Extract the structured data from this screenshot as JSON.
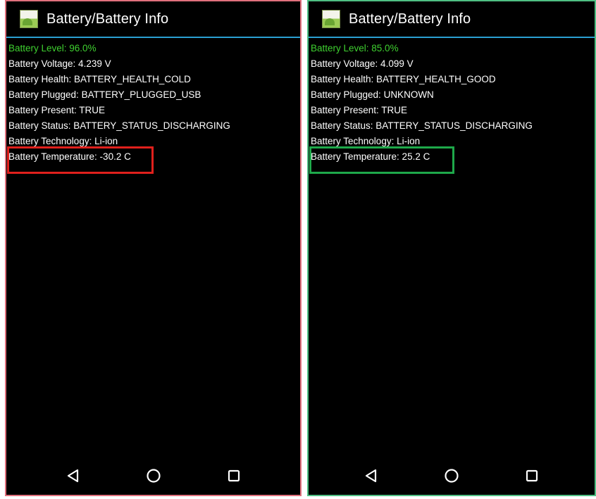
{
  "colors": {
    "left_frame": "#e0707c",
    "right_frame": "#4fbf83",
    "left_highlight": "#e0201c",
    "right_highlight": "#1ea84a",
    "level_text": "#3fd130",
    "title_underline": "#2a9fd2"
  },
  "left": {
    "title": "Battery/Battery Info",
    "icon": "battery-app-icon",
    "lines": [
      "Battery Level: 96.0%",
      "Battery Voltage: 4.239 V",
      "Battery Health: BATTERY_HEALTH_COLD",
      "Battery Plugged: BATTERY_PLUGGED_USB",
      "Battery Present: TRUE",
      "Battery Status: BATTERY_STATUS_DISCHARGING",
      "Battery Technology: Li-ion",
      "Battery Temperature: -30.2 C"
    ]
  },
  "right": {
    "title": "Battery/Battery Info",
    "icon": "battery-app-icon",
    "lines": [
      "Battery Level: 85.0%",
      "Battery Voltage: 4.099 V",
      "Battery Health: BATTERY_HEALTH_GOOD",
      "Battery Plugged: UNKNOWN",
      "Battery Present: TRUE",
      "Battery Status: BATTERY_STATUS_DISCHARGING",
      "Battery Technology: Li-ion",
      "Battery Temperature: 25.2 C"
    ]
  },
  "navbar": {
    "back_icon": "back-triangle-icon",
    "home_icon": "home-circle-icon",
    "recents_icon": "recents-square-icon"
  }
}
